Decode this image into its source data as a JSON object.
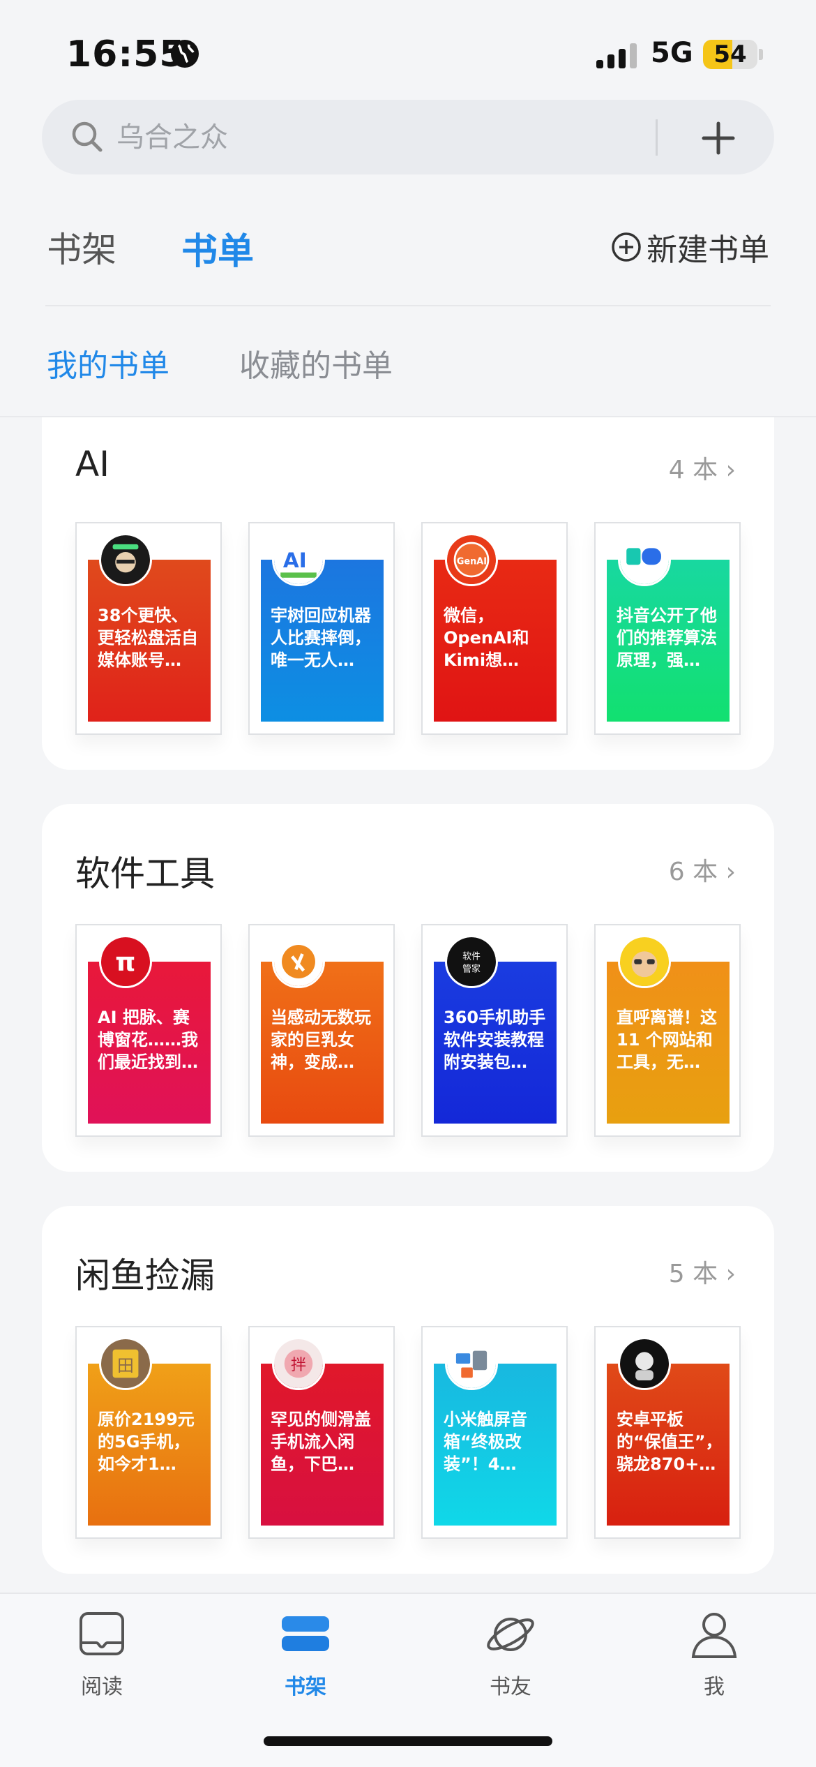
{
  "status": {
    "time": "16:55",
    "network": "5G",
    "battery": "54",
    "battery_level": 0.54
  },
  "search": {
    "placeholder": "乌合之众"
  },
  "tabs": {
    "shelf": "书架",
    "booklist": "书单",
    "new_list": "新建书单"
  },
  "subtabs": {
    "mine": "我的书单",
    "favorites": "收藏的书单"
  },
  "sections": [
    {
      "title": "AI",
      "count": "4 本",
      "books": [
        {
          "title": "38个更快、更轻松盘活自媒体账号…",
          "color_top": "#e04a1c",
          "color_bottom": "#e0221a",
          "avatar": "dark",
          "avatar_text": ""
        },
        {
          "title": "宇树回应机器人比赛摔倒，唯一无人…",
          "color_top": "#1c76e0",
          "color_bottom": "#0d8fe3",
          "avatar": "ai",
          "avatar_text": "AI"
        },
        {
          "title": "微信，OpenAI和Kimi想…",
          "color_top": "#e82a14",
          "color_bottom": "#e01414",
          "avatar": "genai",
          "avatar_text": "GenAI"
        },
        {
          "title": "抖音公开了他们的推荐算法原理，强…",
          "color_top": "#18d8a0",
          "color_bottom": "#12e070",
          "avatar": "teal",
          "avatar_text": ""
        }
      ]
    },
    {
      "title": "软件工具",
      "count": "6 本",
      "books": [
        {
          "title": "AI 把脉、赛博窗花……我们最近找到…",
          "color_top": "#e8183a",
          "color_bottom": "#e01258",
          "avatar": "pi",
          "avatar_text": "π"
        },
        {
          "title": "当感动无数玩家的巨乳女神，变成…",
          "color_top": "#f07018",
          "color_bottom": "#e84a10",
          "avatar": "orange",
          "avatar_text": ""
        },
        {
          "title": "360手机助手软件安装教程附安装包…",
          "color_top": "#1a3ce0",
          "color_bottom": "#1428d8",
          "avatar": "dark2",
          "avatar_text": "软件管家"
        },
        {
          "title": "直呼离谱！这11 个网站和工具，无…",
          "color_top": "#f09018",
          "color_bottom": "#e8a010",
          "avatar": "face",
          "avatar_text": ""
        }
      ]
    },
    {
      "title": "闲鱼捡漏",
      "count": "5 本",
      "books": [
        {
          "title": "原价2199元的5G手机，如今才1…",
          "color_top": "#f0a018",
          "color_bottom": "#e87010",
          "avatar": "brown",
          "avatar_text": "田"
        },
        {
          "title": "罕见的侧滑盖手机流入闲鱼，下巴…",
          "color_top": "#e0182a",
          "color_bottom": "#d81040",
          "avatar": "pink",
          "avatar_text": "拌"
        },
        {
          "title": "小米触屏音箱“终极改装”！4…",
          "color_top": "#18b8e0",
          "color_bottom": "#10d8e8",
          "avatar": "devices",
          "avatar_text": ""
        },
        {
          "title": "安卓平板的“保值王”，骁龙870+…",
          "color_top": "#e04a18",
          "color_bottom": "#d82010",
          "avatar": "dark3",
          "avatar_text": ""
        }
      ]
    }
  ],
  "tabbar": {
    "read": "阅读",
    "shelf": "书架",
    "friends": "书友",
    "me": "我"
  }
}
